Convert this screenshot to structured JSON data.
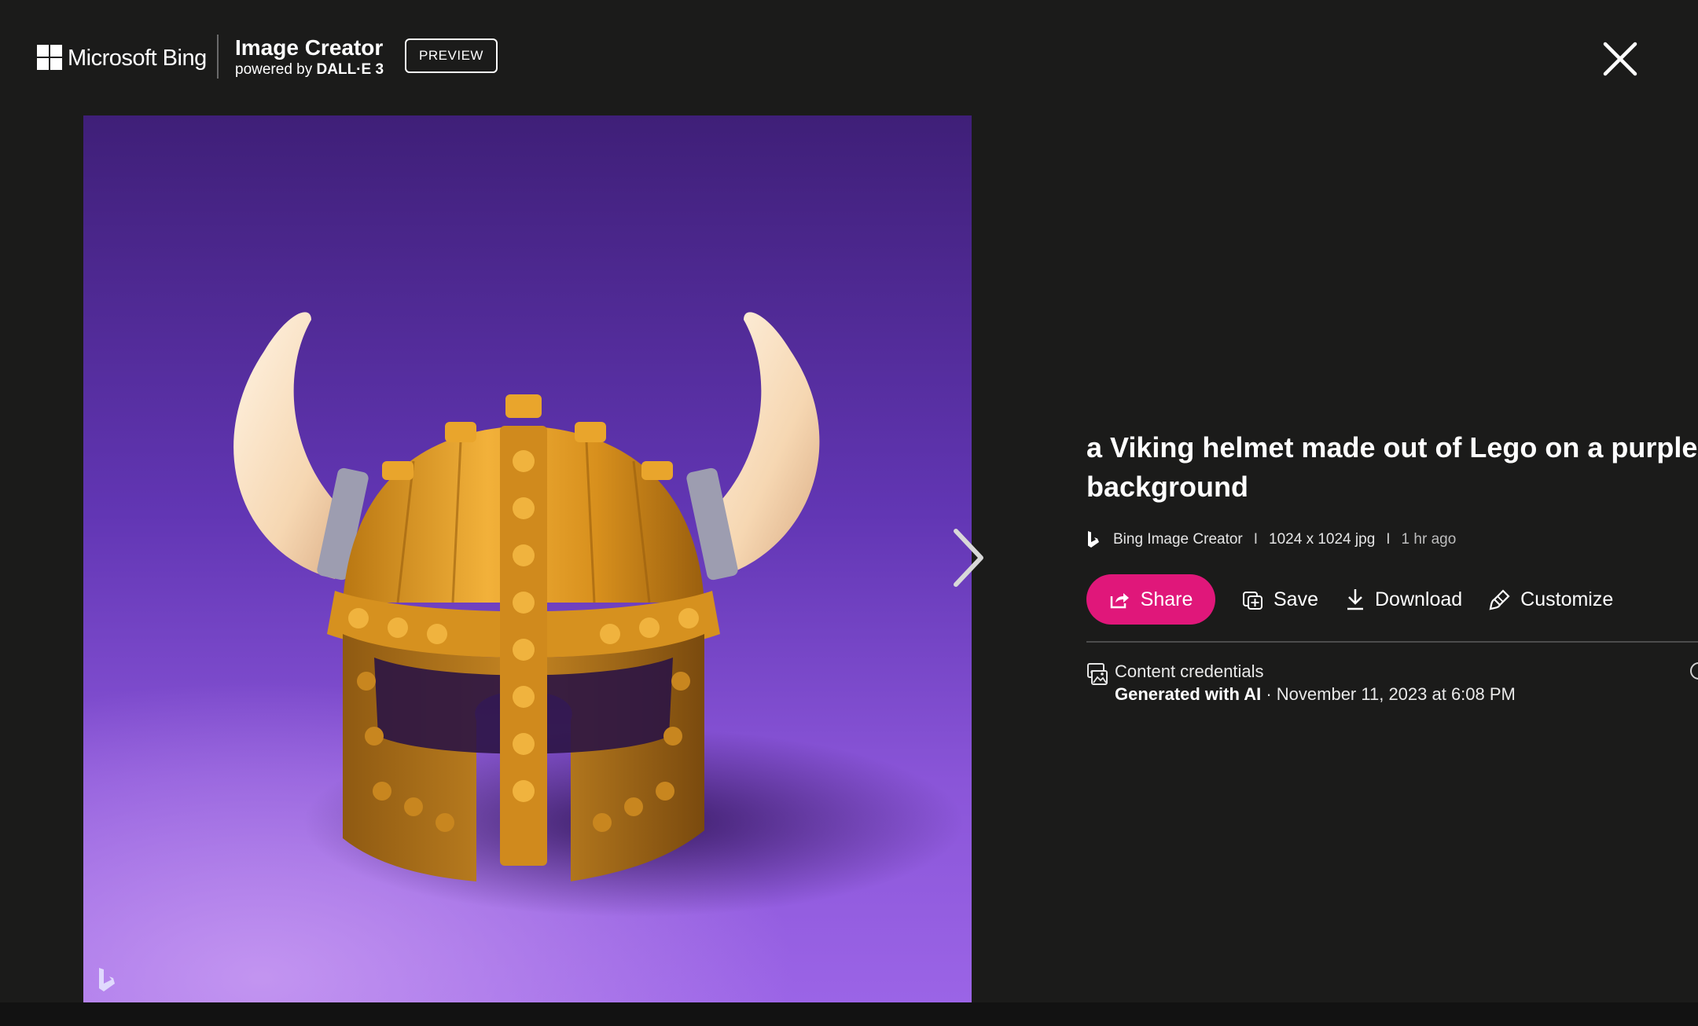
{
  "header": {
    "brand": "Microsoft Bing",
    "app_title": "Image Creator",
    "powered_prefix": "powered by",
    "powered_model": "DALL·E 3",
    "badge": "PREVIEW",
    "close_icon": "close-icon"
  },
  "image": {
    "subject_icon": "lego-viking-helmet-image",
    "watermark_icon": "bing-logo-icon",
    "next_icon": "chevron-right-icon"
  },
  "details": {
    "title": "a Viking helmet made out of Lego on a purple background",
    "source": "Bing Image Creator",
    "separator": "I",
    "dimensions": "1024 x 1024 jpg",
    "age": "1 hr ago"
  },
  "actions": {
    "share": "Share",
    "save": "Save",
    "download": "Download",
    "customize": "Customize"
  },
  "credentials": {
    "title": "Content credentials",
    "generated": "Generated with AI",
    "dot": " · ",
    "date": "November 11, 2023 at 6:08 PM"
  },
  "colors": {
    "background": "#1b1b1a",
    "accent": "#e0177a",
    "image_bg": "#6a3fc0"
  }
}
